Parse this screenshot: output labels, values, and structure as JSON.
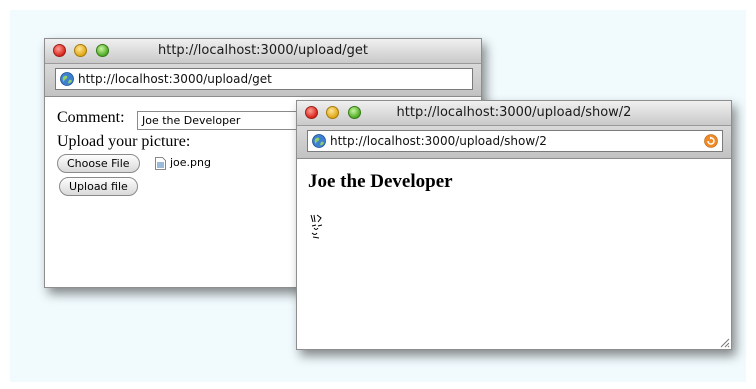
{
  "upload_window": {
    "title": "http://localhost:3000/upload/get",
    "address": "http://localhost:3000/upload/get",
    "comment_label": "Comment:",
    "comment_value": "Joe the Developer",
    "upload_label": "Upload your picture:",
    "choose_file_button": "Choose File",
    "chosen_file": "joe.png",
    "upload_button": "Upload file"
  },
  "show_window": {
    "title": "http://localhost:3000/upload/show/2",
    "address": "http://localhost:3000/upload/show/2",
    "heading": "Joe the Developer"
  },
  "icons": {
    "window_controls": [
      "close-icon",
      "minimize-icon",
      "zoom-icon"
    ],
    "address_globe": "globe-icon",
    "reload": "reload-icon",
    "resize": "resize-grip-icon",
    "file": "file-icon",
    "picture": "face-sketch-image"
  },
  "colors": {
    "background_panel": "#f1fbfe",
    "close": "#d8261c",
    "minimize": "#e0a812",
    "zoom": "#4fab25",
    "reload": "#f08a24"
  }
}
